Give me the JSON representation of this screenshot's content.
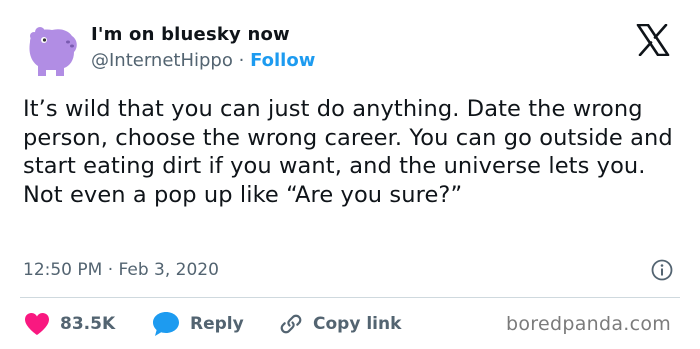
{
  "author": {
    "display_name": "I'm on bluesky now",
    "handle": "@InternetHippo",
    "separator": "·",
    "follow_label": "Follow",
    "avatar_icon": "purple-hippo-avatar"
  },
  "brand_icon": "x-logo-icon",
  "tweet": {
    "text": "It’s wild that you can just do anything. Date the wrong person, choose the wrong career. You can go outside and start eating dirt if you want, and the universe lets you. Not even a pop up like “Are you sure?”",
    "time": "12:50 PM",
    "separator": "·",
    "date": "Feb 3, 2020"
  },
  "actions": {
    "likes_count": "83.5K",
    "reply_label": "Reply",
    "copy_link_label": "Copy link"
  },
  "watermark": "boredpanda.com",
  "colors": {
    "accent": "#1d9bf0",
    "like": "#f91880",
    "secondary_text": "#536471",
    "avatar": "#b18de4"
  }
}
